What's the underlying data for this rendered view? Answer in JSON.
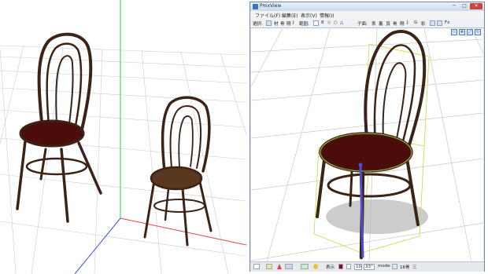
{
  "window": {
    "title": "PmxView",
    "buttons": {
      "minimize": "─",
      "maximize": "□",
      "close": "✕"
    }
  },
  "menu": {
    "items": [
      "ファイル(F)",
      "編集(E)",
      "表示(V)",
      "情報(I)"
    ]
  },
  "toolbar": {
    "select_label": "選択:",
    "select_items": [
      "頂",
      "材",
      "骨",
      "剛",
      "J"
    ],
    "range_label": "範囲:",
    "range_items": [
      "□",
      "8",
      "◇",
      "○",
      "△"
    ],
    "axis_label": "子面:",
    "axis_items": [
      "表",
      "裏",
      "頂",
      "骨",
      "剛",
      "J",
      "G",
      "影"
    ],
    "extra_label": "Fx"
  },
  "viewport_tools": [
    "▭",
    "✥",
    "⤢",
    "↻"
  ],
  "statusbar": {
    "texture_label": "表示",
    "camera_value": "10",
    "angle_value": "33°",
    "mode_label": "mode",
    "bone_label": "16骨",
    "equal_label": "三"
  },
  "colors": {
    "grid_line": "#c9c9c9",
    "axis_green": "#3ec74b",
    "axis_red": "#e04545",
    "axis_blue": "#3a4fd6",
    "chair_wood": "#3b2416",
    "seat_red": "#4a0d0a",
    "seat_brown": "#5a3820",
    "selection_yellow": "#c9d84a",
    "bone_blue": "#4b4fd8",
    "title_accent": "#3a6fc4"
  }
}
